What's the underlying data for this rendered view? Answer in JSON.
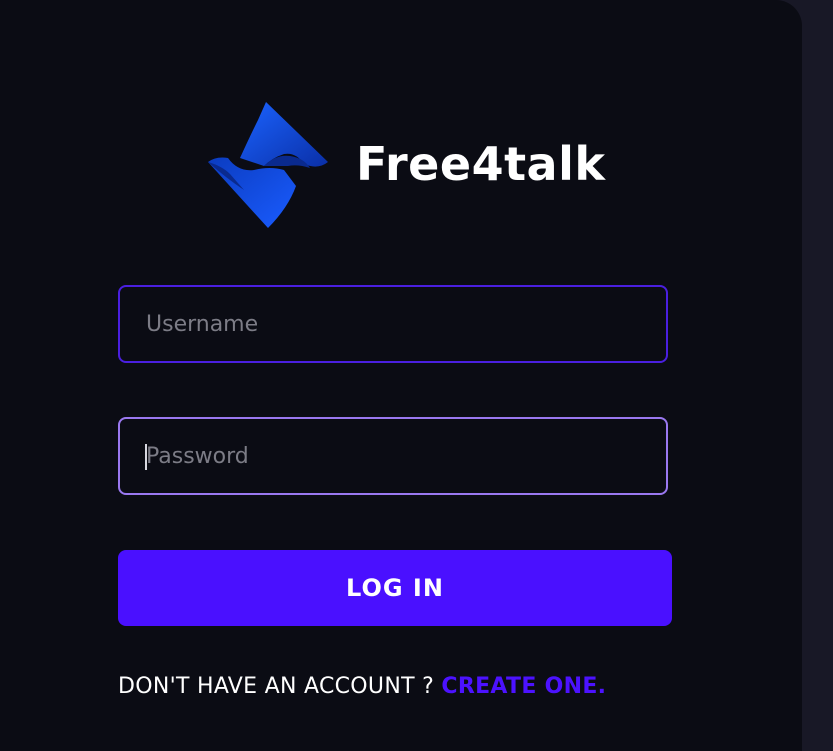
{
  "brand": {
    "name": "Free4talk",
    "logo_icon": "free4talk-logo-icon"
  },
  "form": {
    "username_placeholder": "Username",
    "password_placeholder": "Password",
    "login_label": "LOG IN"
  },
  "signup": {
    "prompt": "DON'T HAVE AN ACCOUNT ? ",
    "link_label": "CREATE ONE."
  },
  "colors": {
    "background": "#0b0c14",
    "accent": "#4a10ff",
    "username_border": "#4a1fe0",
    "password_border_focused": "#9a78f0",
    "logo_blue": "#0f4bd6"
  }
}
